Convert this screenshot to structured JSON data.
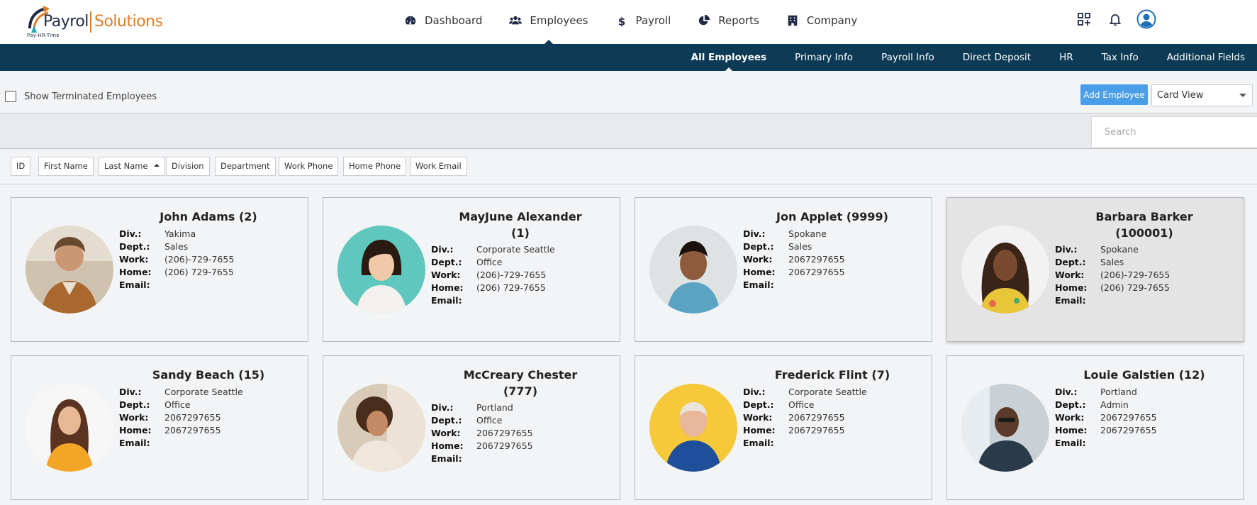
{
  "brand": {
    "name_part1": "Payroll",
    "name_part2": "Solutions",
    "tagline": "Pay-HR-Time"
  },
  "main_nav": [
    {
      "label": "Dashboard",
      "icon": "dashboard-icon",
      "active": false
    },
    {
      "label": "Employees",
      "icon": "users-icon",
      "active": true
    },
    {
      "label": "Payroll",
      "icon": "dollar-icon",
      "active": false
    },
    {
      "label": "Reports",
      "icon": "pie-chart-icon",
      "active": false
    },
    {
      "label": "Company",
      "icon": "building-icon",
      "active": false
    }
  ],
  "top_icons": [
    "apps-icon",
    "bell-icon",
    "user-avatar-icon"
  ],
  "sub_nav": [
    {
      "label": "All Employees",
      "active": true
    },
    {
      "label": "Primary Info",
      "active": false
    },
    {
      "label": "Payroll Info",
      "active": false
    },
    {
      "label": "Direct Deposit",
      "active": false
    },
    {
      "label": "HR",
      "active": false
    },
    {
      "label": "Tax Info",
      "active": false
    },
    {
      "label": "Additional Fields",
      "active": false
    }
  ],
  "toolbar": {
    "show_terminated_label": "Show Terminated Employees",
    "show_terminated_checked": false,
    "add_employee_label": "Add Employee",
    "view_selected": "Card View"
  },
  "search": {
    "placeholder": "Search",
    "value": ""
  },
  "sort_columns": [
    {
      "label": "ID",
      "sorted": false
    },
    {
      "label": "First Name",
      "sorted": false
    },
    {
      "label": "Last Name",
      "sorted": true,
      "direction": "asc"
    },
    {
      "label": "Division",
      "sorted": false
    },
    {
      "label": "Department",
      "sorted": false
    },
    {
      "label": "Work Phone",
      "sorted": false
    },
    {
      "label": "Home Phone",
      "sorted": false
    },
    {
      "label": "Work Email",
      "sorted": false
    }
  ],
  "field_labels": {
    "div": "Div.:",
    "dept": "Dept.:",
    "work": "Work:",
    "home": "Home:",
    "email": "Email:"
  },
  "employees": [
    {
      "name_line1": "John Adams (2)",
      "name_line2": "",
      "div": "Yakima",
      "dept": "Sales",
      "work": "(206)-729-7655",
      "home": "(206) 729-7655",
      "email": ""
    },
    {
      "name_line1": "MayJune Alexander",
      "name_line2": "(1)",
      "div": "Corporate Seattle",
      "dept": "Office",
      "work": "(206)-729-7655",
      "home": "(206) 729-7655",
      "email": ""
    },
    {
      "name_line1": "Jon Applet (9999)",
      "name_line2": "",
      "div": "Spokane",
      "dept": "Sales",
      "work": "2067297655",
      "home": "2067297655",
      "email": ""
    },
    {
      "name_line1": "Barbara Barker",
      "name_line2": "(100001)",
      "div": "Spokane",
      "dept": "Sales",
      "work": "(206)-729-7655",
      "home": "(206) 729-7655",
      "email": ""
    },
    {
      "name_line1": "Sandy Beach (15)",
      "name_line2": "",
      "div": "Corporate Seattle",
      "dept": "Office",
      "work": "2067297655",
      "home": "2067297655",
      "email": ""
    },
    {
      "name_line1": "McCreary Chester",
      "name_line2": "(777)",
      "div": "Portland",
      "dept": "Office",
      "work": "2067297655",
      "home": "2067297655",
      "email": ""
    },
    {
      "name_line1": "Frederick Flint (7)",
      "name_line2": "",
      "div": "Corporate Seattle",
      "dept": "Office",
      "work": "2067297655",
      "home": "2067297655",
      "email": ""
    },
    {
      "name_line1": "Louie Galstien (12)",
      "name_line2": "",
      "div": "Portland",
      "dept": "Admin",
      "work": "2067297655",
      "home": "2067297655",
      "email": ""
    }
  ],
  "colors": {
    "accent": "#0d3a55",
    "primary_button": "#4a9ee8",
    "brand_orange": "#e07d22"
  }
}
